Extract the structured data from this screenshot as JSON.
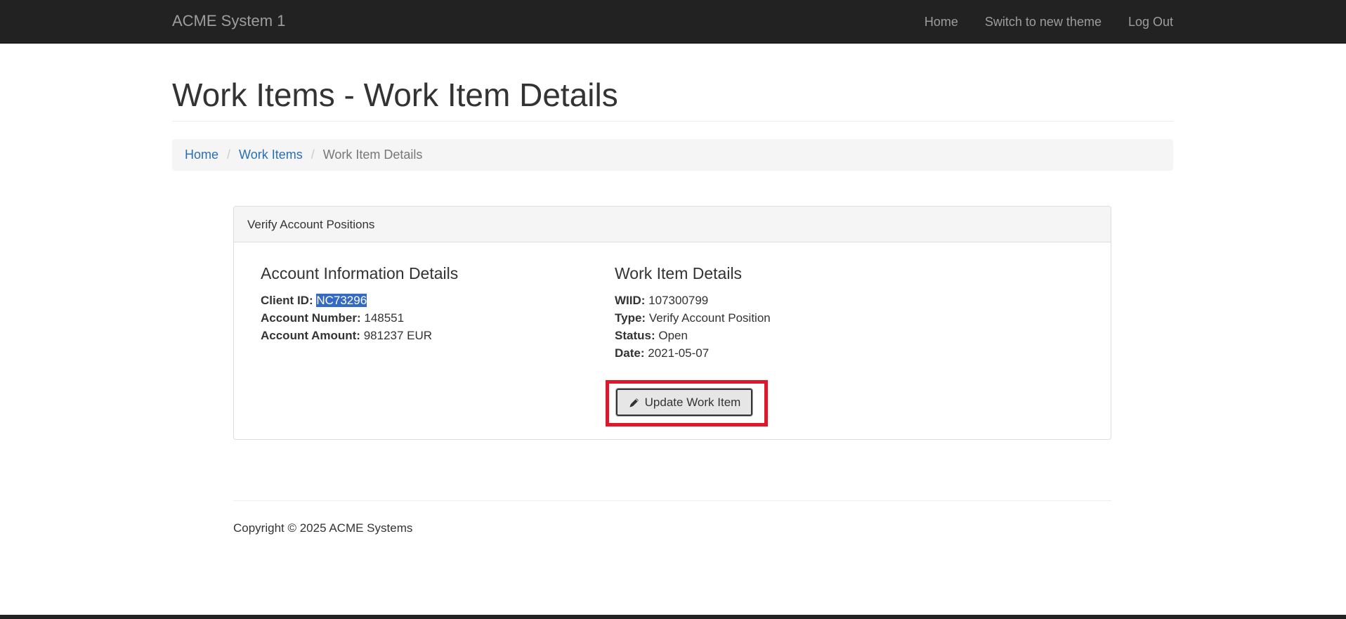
{
  "navbar": {
    "brand": "ACME System 1",
    "links": [
      "Home",
      "Switch to new theme",
      "Log Out"
    ]
  },
  "page": {
    "title": "Work Items - Work Item Details"
  },
  "breadcrumb": {
    "items": [
      "Home",
      "Work Items"
    ],
    "separator": "/",
    "active": "Work Item Details"
  },
  "panel": {
    "heading": "Verify Account Positions",
    "account": {
      "title": "Account Information Details",
      "fields": [
        {
          "label": "Client ID:",
          "value": "NC73296"
        },
        {
          "label": "Account Number:",
          "value": "148551"
        },
        {
          "label": "Account Amount:",
          "value": "981237 EUR"
        }
      ]
    },
    "work_item": {
      "title": "Work Item Details",
      "fields": [
        {
          "label": "WIID:",
          "value": "107300799"
        },
        {
          "label": "Type:",
          "value": "Verify Account Position"
        },
        {
          "label": "Status:",
          "value": "Open"
        },
        {
          "label": "Date:",
          "value": "2021-05-07"
        }
      ]
    },
    "update_button": {
      "label": "Update Work Item",
      "icon": "pencil-icon"
    }
  },
  "footer": {
    "copyright": "Copyright © 2025 ACME Systems"
  },
  "colors": {
    "navbar_bg": "#222222",
    "link": "#2a6fb5",
    "selection": "#3469c6",
    "highlight_border": "#e0162b"
  }
}
